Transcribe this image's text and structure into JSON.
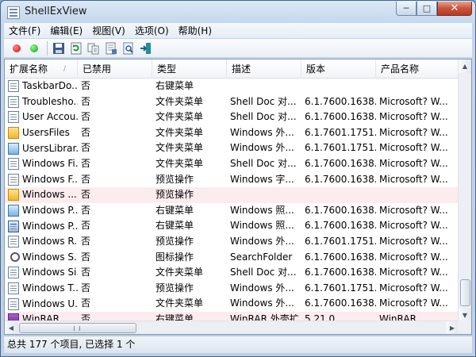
{
  "window": {
    "title": "ShellExView"
  },
  "caption": {
    "minimize": "─",
    "maximize": "□",
    "close": "✕"
  },
  "menu": [
    "文件(F)",
    "编辑(E)",
    "视图(V)",
    "选项(O)",
    "帮助(H)"
  ],
  "toolbar": {
    "icons": [
      "disable-icon",
      "enable-icon",
      "save-icon",
      "refresh-icon",
      "copy-icon",
      "properties-icon",
      "find-icon",
      "exit-icon"
    ]
  },
  "columns": [
    "扩展名称",
    "已禁用",
    "类型",
    "描述",
    "版本",
    "产品名称"
  ],
  "rows": [
    {
      "name": "TaskbarDo...",
      "disabled": "否",
      "type": "右键菜单",
      "desc": "",
      "version": "",
      "product": "",
      "icon": "doc",
      "highlight": true
    },
    {
      "name": "Troublesho...",
      "disabled": "否",
      "type": "文件夹菜单",
      "desc": "Shell Doc 对...",
      "version": "6.1.7600.1638...",
      "product": "Microsoft? W...",
      "icon": "doc",
      "highlight": false
    },
    {
      "name": "User Accou...",
      "disabled": "否",
      "type": "文件夹菜单",
      "desc": "Shell Doc 对...",
      "version": "6.1.7600.1638...",
      "product": "Microsoft? W...",
      "icon": "doc",
      "highlight": false
    },
    {
      "name": "UsersFiles",
      "disabled": "否",
      "type": "文件夹菜单",
      "desc": "Windows 外...",
      "version": "6.1.7601.1751...",
      "product": "Microsoft? W...",
      "icon": "folder",
      "highlight": false
    },
    {
      "name": "UsersLibrar...",
      "disabled": "否",
      "type": "文件夹菜单",
      "desc": "Windows 外...",
      "version": "6.1.7601.1751...",
      "product": "Microsoft? W...",
      "icon": "panel",
      "highlight": false
    },
    {
      "name": "Windows Fi...",
      "disabled": "否",
      "type": "文件夹菜单",
      "desc": "Shell Doc 对...",
      "version": "6.1.7600.1638...",
      "product": "Microsoft? W...",
      "icon": "doc",
      "highlight": false
    },
    {
      "name": "Windows F...",
      "disabled": "否",
      "type": "预览操作",
      "desc": "Windows 字...",
      "version": "6.1.7600.1638...",
      "product": "Microsoft? W...",
      "icon": "doc",
      "highlight": false
    },
    {
      "name": "Windows ...",
      "disabled": "否",
      "type": "预览操作",
      "desc": "",
      "version": "",
      "product": "",
      "icon": "folder",
      "highlight": true
    },
    {
      "name": "Windows P...",
      "disabled": "否",
      "type": "右键菜单",
      "desc": "Windows 照...",
      "version": "6.1.7600.1638...",
      "product": "Microsoft? W...",
      "icon": "panel",
      "highlight": false
    },
    {
      "name": "Windows P...",
      "disabled": "否",
      "type": "右键菜单",
      "desc": "Windows 照...",
      "version": "6.1.7600.1638...",
      "product": "Microsoft? W...",
      "icon": "doc",
      "highlight": false
    },
    {
      "name": "Windows R...",
      "disabled": "否",
      "type": "预览操作",
      "desc": "Windows 外...",
      "version": "6.1.7601.1751...",
      "product": "Microsoft? W...",
      "icon": "doc",
      "highlight": false
    },
    {
      "name": "Windows S...",
      "disabled": "否",
      "type": "图标操作",
      "desc": "SearchFolder",
      "version": "6.1.7600.1638...",
      "product": "Microsoft? W...",
      "icon": "search",
      "highlight": false
    },
    {
      "name": "Windows Si...",
      "disabled": "否",
      "type": "文件夹菜单",
      "desc": "Shell Doc 对...",
      "version": "6.1.7600.1638...",
      "product": "Microsoft? W...",
      "icon": "doc",
      "highlight": false
    },
    {
      "name": "Windows T...",
      "disabled": "否",
      "type": "预览操作",
      "desc": "Windows 外...",
      "version": "6.1.7601.1751...",
      "product": "Microsoft? W...",
      "icon": "doc",
      "highlight": false
    },
    {
      "name": "Windows U...",
      "disabled": "否",
      "type": "文件夹菜单",
      "desc": "Windows 外...",
      "version": "6.1.7600.1638...",
      "product": "Microsoft? W...",
      "icon": "doc",
      "highlight": false
    },
    {
      "name": "WinRAR",
      "disabled": "否",
      "type": "右键菜单",
      "desc": "WinRAR 外壳扩...",
      "version": "5.21.0",
      "product": "WinRAR",
      "icon": "rar",
      "highlight": true
    }
  ],
  "status": {
    "text": "总共 177 个项目, 已选择 1 个"
  }
}
